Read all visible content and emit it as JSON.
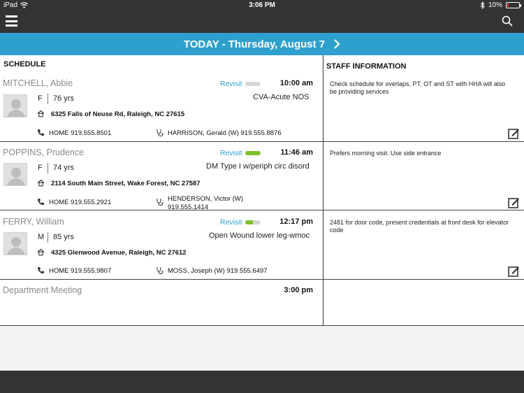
{
  "status_bar": {
    "device": "iPad",
    "time": "3:06 PM",
    "battery": "10%"
  },
  "nav": {
    "menu_icon": "hamburger-icon",
    "search_icon": "search-icon"
  },
  "date_banner": {
    "text": "TODAY - Thursday, August 7",
    "next_icon": "chevron-right-icon"
  },
  "schedule_header": "SCHEDULE",
  "staff_header": "STAFF INFORMATION",
  "visits": [
    {
      "name": "MITCHELL, Abbie",
      "revisit_label": "Revisit",
      "revisit_progress": 0,
      "time": "10:00 am",
      "diagnosis": "CVA-Acute NOS",
      "gender": "F",
      "age": "76 yrs",
      "address": "6325 Falls of Neuse Rd, Raleigh, NC 27615",
      "phone": "HOME 919.555.8501",
      "doctor": "HARRISON, Gerald  (W) 919.555.8876",
      "staff_note": "Check schedule for overlaps, PT, OT and ST with HHA will also be providing services"
    },
    {
      "name": "POPPINS, Prudence",
      "revisit_label": "Revisit",
      "revisit_progress": 1,
      "time": "11:46 am",
      "diagnosis": "DM Type I w/periph circ disord",
      "gender": "F",
      "age": "74 yrs",
      "address": "2114 South Main Street, Wake Forest, NC 27587",
      "phone": "HOME 919.555.2921",
      "doctor_line1": "HENDERSON, Victor  (W)",
      "doctor_line2": "919.555.1414",
      "staff_note": "Prefers morning visit. Use side entrance"
    },
    {
      "name": "FERRY, William",
      "revisit_label": "Revisit",
      "revisit_progress": 0.5,
      "time": "12:17 pm",
      "diagnosis": "Open Wound lower leg-wmoc",
      "gender": "M",
      "age": "85 yrs",
      "address": "4325 Glenwood Avenue, Raleigh, NC 27612",
      "phone": "HOME 919.555.9807",
      "doctor": "MOSS, Joseph  (W) 919.555.6497",
      "staff_note": "2481 for door code, present credentials at front desk for elevator code"
    }
  ],
  "meeting": {
    "name": "Department Meeting",
    "time": "3:00 pm"
  },
  "colors": {
    "accent": "#2ea0cd",
    "bar_dark": "#333333",
    "progress_green": "#7ec12d",
    "progress_track": "#d6d6d6"
  }
}
